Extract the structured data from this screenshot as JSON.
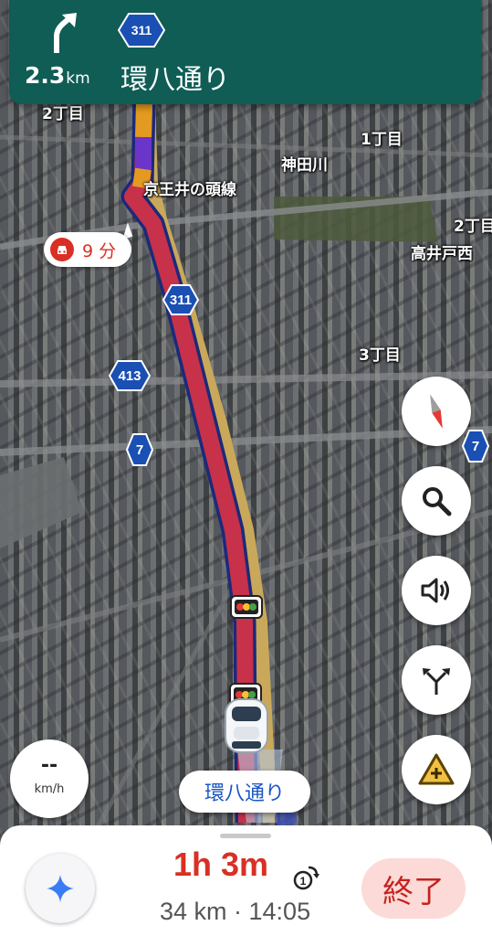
{
  "banner": {
    "distance_value": "2.3",
    "distance_unit": "km",
    "route_shield": "311",
    "road_name": "環八通り",
    "turn_icon": "turn-slight-right-icon",
    "bg_color": "#0f5d55"
  },
  "map": {
    "places": {
      "p_2chome_top": "2丁目",
      "p_1chome": "1丁目",
      "p_kandagawa": "神田川",
      "p_keio": "京王井の頭線",
      "p_2chome_right": "2丁目",
      "p_takaido": "高井戸西",
      "p_3chome": "3丁目"
    },
    "shields": {
      "s311": "311",
      "s413": "413",
      "s7_left": "7",
      "s7_right": "7"
    },
    "traffic_bubble": {
      "icon": "car-traffic-icon",
      "text": "9 分"
    },
    "route_colors": {
      "heavy": "#c8314a",
      "moderate": "#e39a20",
      "slow": "#6a35c8",
      "outline": "#1b2a7a"
    }
  },
  "controls": {
    "compass_icon": "compass-icon",
    "search_icon": "search-icon",
    "sound_icon": "volume-icon",
    "alternate_routes_icon": "route-options-icon",
    "report_icon": "report-incident-icon"
  },
  "speed": {
    "value": "--",
    "unit": "km/h"
  },
  "current_road": "環八通り",
  "bottom_sheet": {
    "eta_duration": "1h 3m",
    "alt_icon": "alternate-route-count-icon",
    "trip_info": "34 km · 14:05",
    "end_button": "終了",
    "assistant_icon": "gemini-sparkle-icon"
  }
}
